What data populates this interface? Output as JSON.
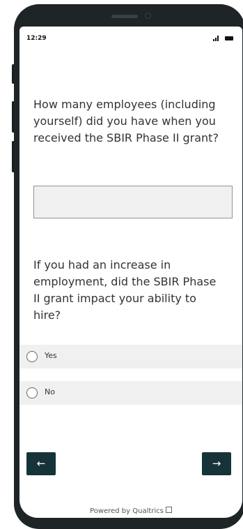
{
  "status_bar": {
    "time": "12:29",
    "signal_icon": "cell-signal-icon",
    "battery_icon": "battery-icon"
  },
  "survey": {
    "question1": {
      "text": "How many employees (including yourself) did you have when you received the SBIR Phase II grant?",
      "answer_value": "",
      "answer_placeholder": ""
    },
    "question2": {
      "text": "If you had an increase in employment, did the SBIR Phase II grant impact your ability to hire?",
      "choices": [
        {
          "label": "Yes",
          "selected": false
        },
        {
          "label": "No",
          "selected": false
        }
      ]
    }
  },
  "navigation": {
    "back_label": "←",
    "next_label": "→"
  },
  "footer": {
    "powered_by": "Powered by Qualtrics",
    "icon": "external-link-icon"
  },
  "colors": {
    "button_bg": "#163339",
    "choice_bg": "#f0f0f0",
    "device_frame": "#1f2426"
  }
}
